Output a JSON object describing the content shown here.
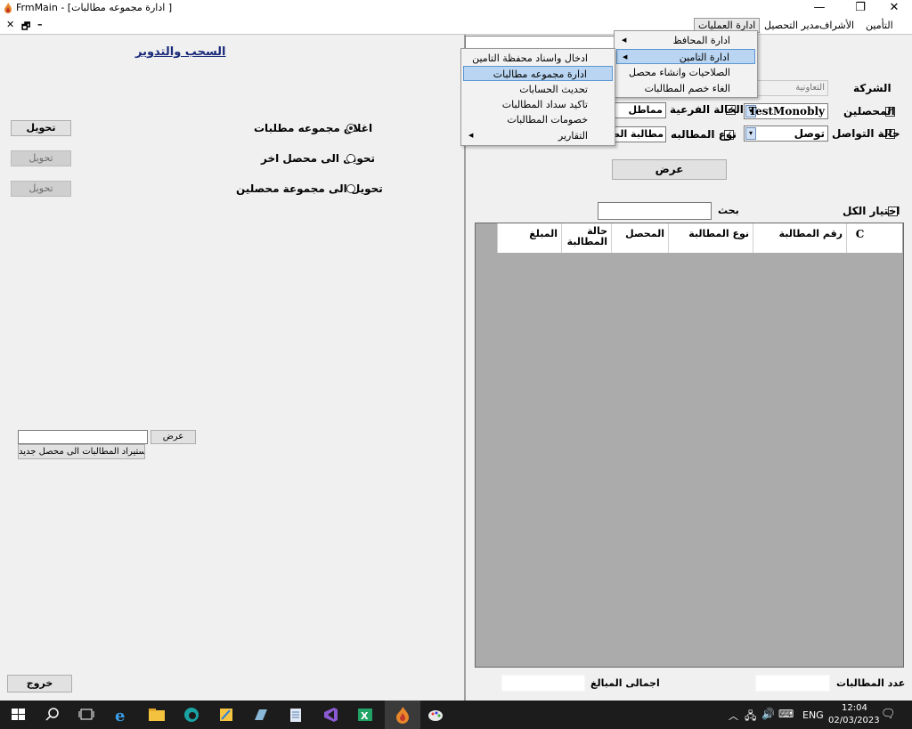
{
  "window": {
    "title": "FrmMain - [ادارة مجموعه مطالبات ]",
    "minimize": "—",
    "restore": "❐",
    "close": "✕"
  },
  "mdi_controls": {
    "close": "✕",
    "restore": "🗗",
    "minimize": "–"
  },
  "menubar": {
    "items": [
      "التأمين",
      "الأشراف",
      "مدير التحصيل",
      "ادارة العمليات"
    ]
  },
  "operations_menu": {
    "items": [
      "ادارة المحافظ",
      "ادارة التامين",
      "الصلاحيات وانشاء محصل",
      "الغاء خصم المطالبات"
    ]
  },
  "insurance_submenu": {
    "items": [
      "ادخال واسناد محفظة التامين",
      "ادارة مجموعه مطالبات",
      "تحديث الحسابات",
      "تاكيد سداد المطالبات",
      "خصومات المطالبات",
      "التقارير"
    ]
  },
  "left": {
    "heading": "السحب والتدوير",
    "options": [
      {
        "label": "اغلاق مجموعه مطلبات",
        "button": "تحويل",
        "selected": true
      },
      {
        "label": "تحويل الى محصل اخر",
        "button": "تحويل",
        "selected": false
      },
      {
        "label": "تحويل الى مجموعة محصلين",
        "button": "تحويل",
        "selected": false
      }
    ],
    "show_button": "عرض",
    "import_button": "استيراد المطالبات الى محصل جديد",
    "exit_button": "خروج"
  },
  "right": {
    "company_label": "الشركة",
    "company_value": "التعاونية",
    "collectors_label": "المحصلين",
    "collectors_value": "TestMonobly",
    "branch_status_label": "الحالة الفرعية",
    "branch_status_value": "مماطل",
    "contact_status_label": "حالة التواصل",
    "contact_status_value": "توصل",
    "claim_type_label": "نوع المطالبه",
    "claim_type_value": "مطالبة الطرف",
    "show_button": "عرض",
    "select_all_label": "اختيار الكل",
    "search_label": "بحث",
    "columns": [
      "C",
      "رقم المطالبة",
      "نوع المطالبة",
      "المحصل",
      "حالة المطالبة",
      "المبلغ"
    ],
    "claims_count_label": "عدد المطالبات",
    "total_amounts_label": "اجمالى المبالغ"
  },
  "taskbar": {
    "tray_lang": "ENG",
    "time": "12:04",
    "date": "02/03/2023"
  }
}
